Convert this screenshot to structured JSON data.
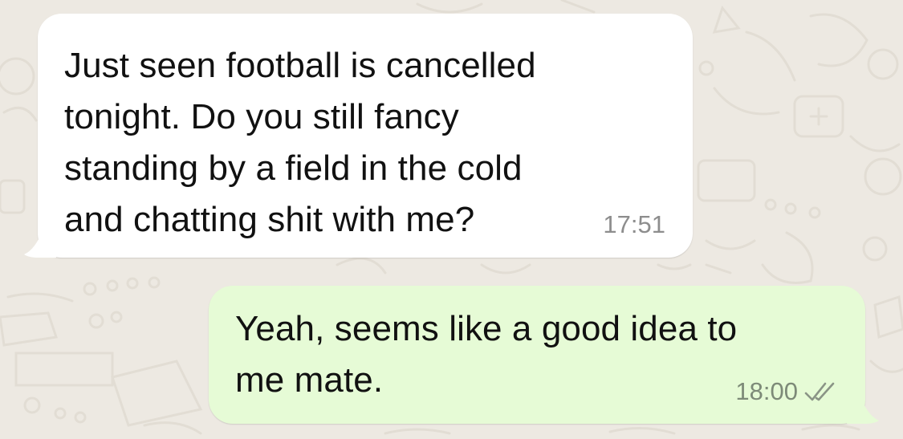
{
  "chat": {
    "messages": [
      {
        "direction": "incoming",
        "text": "Just seen football is cancelled\ntonight. Do you still fancy\nstanding by a field in the cold\nand chatting shit with me?",
        "time": "17:51"
      },
      {
        "direction": "outgoing",
        "text": "Yeah, seems like a good idea to\nme mate.",
        "time": "18:00",
        "status_icon": "double-check-icon"
      }
    ]
  },
  "colors": {
    "background": "#ede9e2",
    "incoming_bubble": "#ffffff",
    "outgoing_bubble": "#e6fbd6",
    "timestamp": "#8d8d8d"
  }
}
